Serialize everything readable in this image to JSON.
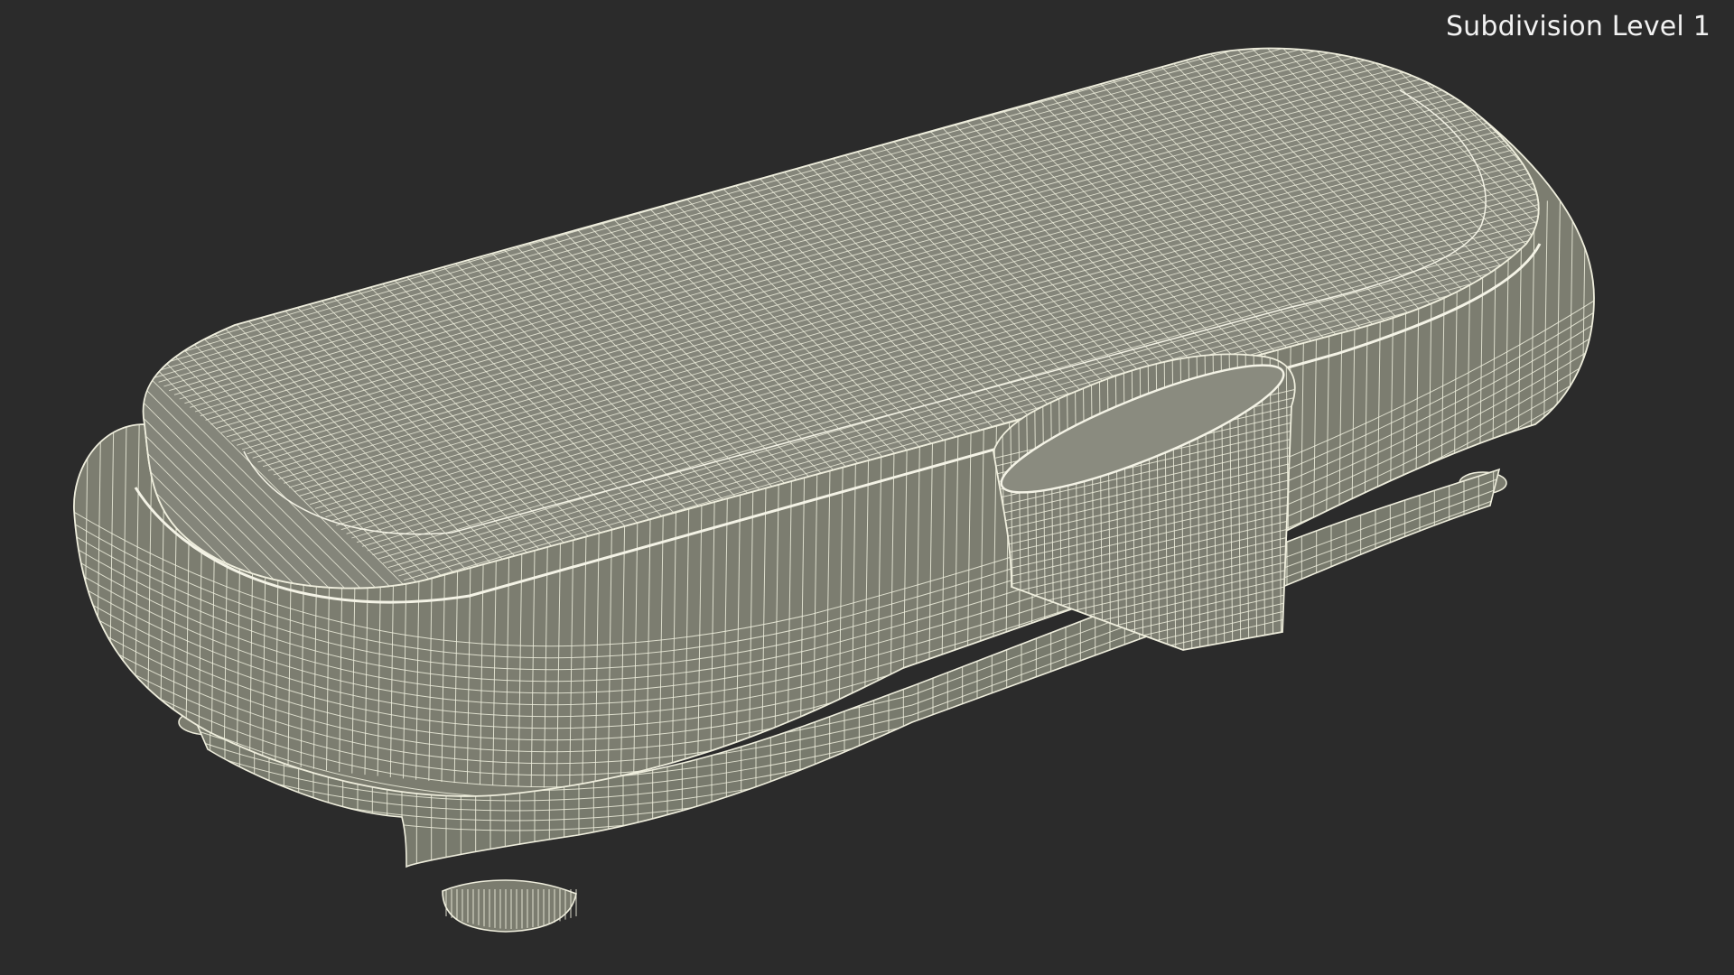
{
  "viewport": {
    "label": "Subdivision Level 1",
    "background_color": "#2b2b2b",
    "surface_color": "#7b7c6f",
    "wire_color": "#efeedd",
    "text_color": "#f2f2f2"
  }
}
